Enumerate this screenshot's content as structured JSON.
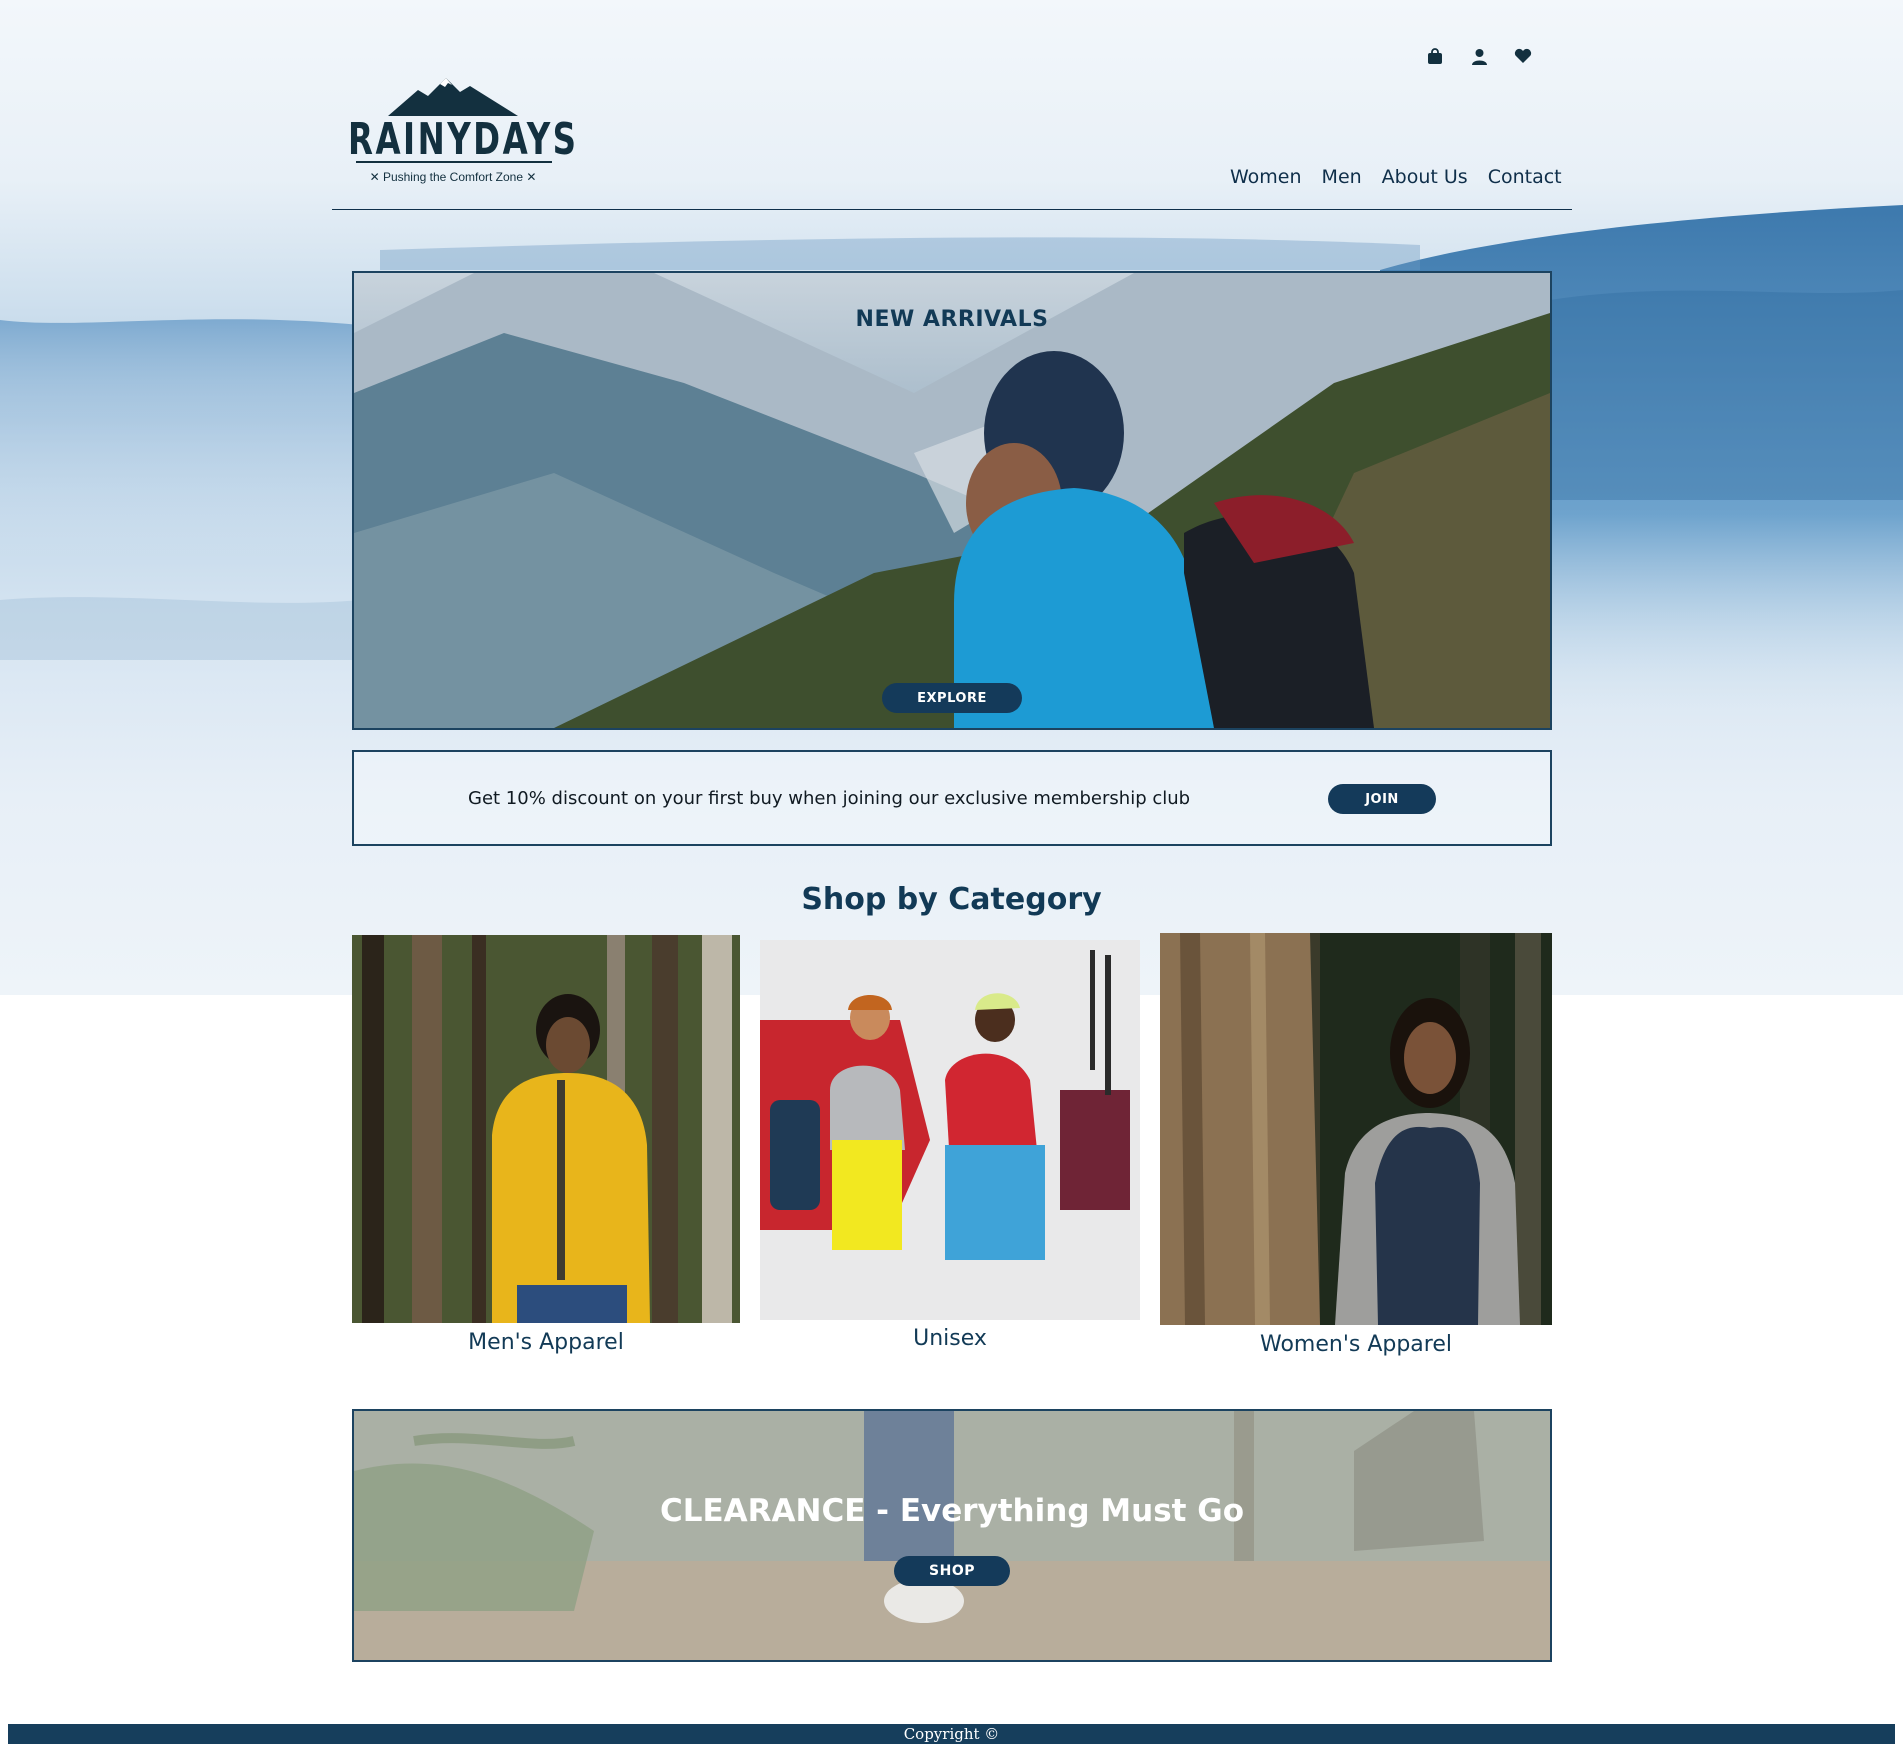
{
  "header": {
    "logo_text": "RAINYDAYS",
    "tagline": "✕ Pushing the Comfort Zone ✕",
    "icons": [
      "shopping-bag-icon",
      "user-icon",
      "heart-icon"
    ],
    "nav": [
      "Women",
      "Men",
      "About Us",
      "Contact"
    ]
  },
  "hero": {
    "title": "NEW ARRIVALS",
    "button": "EXPLORE"
  },
  "membership": {
    "text": "Get 10% discount on your first buy when joining our exclusive membership club",
    "button": "JOIN"
  },
  "categories": {
    "title": "Shop by Category",
    "items": [
      {
        "label": "Men's Apparel"
      },
      {
        "label": "Unisex"
      },
      {
        "label": "Women's Apparel"
      }
    ]
  },
  "clearance": {
    "title": "CLEARANCE - Everything Must Go",
    "button": "SHOP"
  },
  "footer": {
    "text": "Copyright ©"
  },
  "colors": {
    "brand_navy": "#143a5a",
    "text_navy": "#123a56",
    "border": "#1c4360"
  }
}
